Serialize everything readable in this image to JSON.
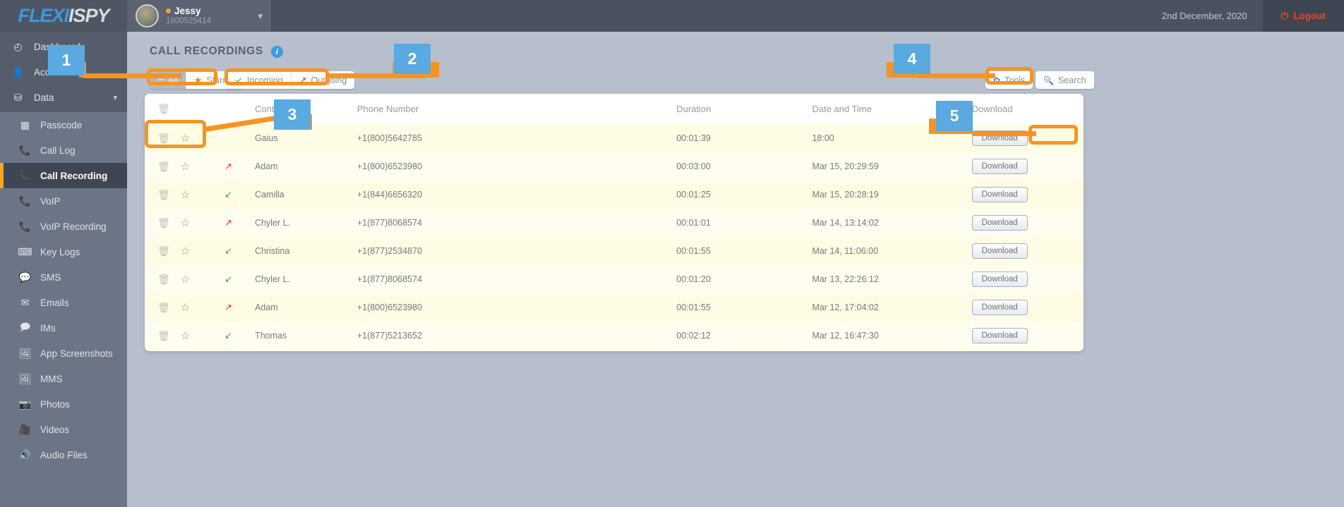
{
  "topbar": {
    "logo_flexi": "FLEXI",
    "logo_spy": "ISPY",
    "user_name": "Jessy",
    "user_id": "1800525414",
    "caret_icon": "▾",
    "date": "2nd December, 2020",
    "logout_label": "Logout",
    "logout_icon": "⏻"
  },
  "sidebar": {
    "top_items": [
      {
        "label": "Dashboard",
        "icon": "◴",
        "name": "dashboard"
      },
      {
        "label": "Account",
        "icon": "👤",
        "name": "account"
      },
      {
        "label": "Data",
        "icon": "⛁",
        "name": "data",
        "caret": "▾"
      }
    ],
    "sub_items": [
      {
        "label": "Passcode",
        "icon": "▦",
        "name": "passcode",
        "active": false
      },
      {
        "label": "Call Log",
        "icon": "📞",
        "name": "call-log",
        "active": false
      },
      {
        "label": "Call Recording",
        "icon": "📞",
        "name": "call-recording",
        "active": true
      },
      {
        "label": "VoIP",
        "icon": "📞",
        "name": "voip",
        "active": false
      },
      {
        "label": "VoIP Recording",
        "icon": "📞",
        "name": "voip-recording",
        "active": false
      },
      {
        "label": "Key Logs",
        "icon": "⌨",
        "name": "key-logs",
        "active": false
      },
      {
        "label": "SMS",
        "icon": "💬",
        "name": "sms",
        "active": false
      },
      {
        "label": "Emails",
        "icon": "✉",
        "name": "emails",
        "active": false
      },
      {
        "label": "IMs",
        "icon": "🗩",
        "name": "ims",
        "active": false
      },
      {
        "label": "App Screenshots",
        "icon": "🖼",
        "name": "app-screenshots",
        "active": false
      },
      {
        "label": "MMS",
        "icon": "🖼",
        "name": "mms",
        "active": false
      },
      {
        "label": "Photos",
        "icon": "📷",
        "name": "photos",
        "active": false
      },
      {
        "label": "Videos",
        "icon": "🎥",
        "name": "videos",
        "active": false
      },
      {
        "label": "Audio Files",
        "icon": "🔊",
        "name": "audio-files",
        "active": false
      }
    ]
  },
  "page": {
    "title": "CALL RECORDINGS",
    "info_icon": "i"
  },
  "filters": {
    "all_label": "All",
    "all_icon": "☰",
    "starred_label": "Starred",
    "starred_icon": "★",
    "incoming_label": "Incoming",
    "incoming_icon": "↙",
    "outgoing_label": "Outgoing",
    "outgoing_icon": "↗"
  },
  "actions": {
    "tools_label": "Tools",
    "tools_icon": "✿",
    "search_label": "Search",
    "search_icon": "🔍"
  },
  "table": {
    "headers": {
      "tools": "",
      "trash_icon": "🗑",
      "contact": "Contact",
      "phone": "Phone Number",
      "duration": "Duration",
      "datetime": "Date and Time",
      "download": "Download"
    },
    "download_label": "Download",
    "trash_icon": "🗑",
    "star_icon": "☆",
    "rows": [
      {
        "direction": "",
        "dir_icon": "",
        "contact": "Gaius",
        "phone": "+1(800)5642785",
        "duration": "00:01:39",
        "datetime": "18:00"
      },
      {
        "direction": "outgoing",
        "dir_icon": "↗",
        "contact": "Adam",
        "phone": "+1(800)6523980",
        "duration": "00:03:00",
        "datetime": "Mar 15, 20:29:59"
      },
      {
        "direction": "incoming",
        "dir_icon": "↙",
        "contact": "Camilla",
        "phone": "+1(844)6656320",
        "duration": "00:01:25",
        "datetime": "Mar 15, 20:28:19"
      },
      {
        "direction": "outgoing",
        "dir_icon": "↗",
        "contact": "Chyler L.",
        "phone": "+1(877)8068574",
        "duration": "00:01:01",
        "datetime": "Mar 14, 13:14:02"
      },
      {
        "direction": "incoming",
        "dir_icon": "↙",
        "contact": "Christina",
        "phone": "+1(877)2534870",
        "duration": "00:01:55",
        "datetime": "Mar 14, 11:06:00"
      },
      {
        "direction": "incoming",
        "dir_icon": "↙",
        "contact": "Chyler L.",
        "phone": "+1(877)8068574",
        "duration": "00:01:20",
        "datetime": "Mar 13, 22:26:12"
      },
      {
        "direction": "outgoing",
        "dir_icon": "↗",
        "contact": "Adam",
        "phone": "+1(800)6523980",
        "duration": "00:01:55",
        "datetime": "Mar 12, 17:04:02"
      },
      {
        "direction": "incoming",
        "dir_icon": "↙",
        "contact": "Thomas",
        "phone": "+1(877)5213652",
        "duration": "00:02:12",
        "datetime": "Mar 12, 16:47:30"
      }
    ]
  },
  "callouts": [
    {
      "number": "1"
    },
    {
      "number": "2"
    },
    {
      "number": "3"
    },
    {
      "number": "4"
    },
    {
      "number": "5"
    }
  ],
  "colors": {
    "accent_orange": "#f79421",
    "badge_blue": "#5aa9e0",
    "logout_red": "#e8472a",
    "incoming_green": "#3faa3f",
    "outgoing_red": "#e0342a"
  }
}
